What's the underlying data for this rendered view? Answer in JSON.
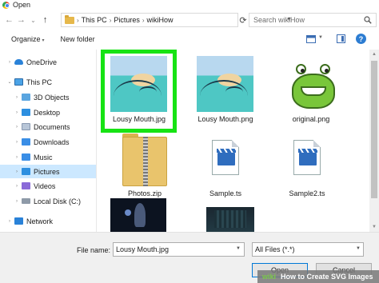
{
  "window": {
    "title": "Open"
  },
  "nav": {
    "back": "←",
    "forward": "→",
    "recent": "⌄",
    "up": "↑"
  },
  "address": {
    "crumbs": [
      "This PC",
      "Pictures",
      "wikiHow"
    ],
    "separator": "›",
    "refresh": "⟳"
  },
  "search": {
    "placeholder": "Search wikiHow",
    "icon": "search-icon"
  },
  "toolbar": {
    "organize": "Organize",
    "new_folder": "New folder",
    "help": "?"
  },
  "sidebar": {
    "items": [
      {
        "label": "OneDrive",
        "icon": "onedrive-icon"
      },
      {
        "label": "This PC",
        "icon": "pc-icon"
      },
      {
        "label": "3D Objects",
        "icon": "3d-objects-icon"
      },
      {
        "label": "Desktop",
        "icon": "desktop-icon"
      },
      {
        "label": "Documents",
        "icon": "documents-icon"
      },
      {
        "label": "Downloads",
        "icon": "downloads-icon"
      },
      {
        "label": "Music",
        "icon": "music-icon"
      },
      {
        "label": "Pictures",
        "icon": "pictures-icon",
        "selected": true
      },
      {
        "label": "Videos",
        "icon": "videos-icon"
      },
      {
        "label": "Local Disk (C:)",
        "icon": "disk-icon"
      },
      {
        "label": "Network",
        "icon": "network-icon"
      }
    ]
  },
  "files": [
    {
      "name": "Lousy Mouth.jpg",
      "selected": true
    },
    {
      "name": "Lousy Mouth.png"
    },
    {
      "name": "original.png"
    },
    {
      "name": "Photos.zip"
    },
    {
      "name": "Sample.ts"
    },
    {
      "name": "Sample2.ts"
    }
  ],
  "footer": {
    "file_name_label": "File name:",
    "file_name_value": "Lousy Mouth.jpg",
    "file_type": "All Files (*.*)",
    "open": "Open",
    "cancel": "Cancel"
  },
  "watermark": {
    "brand": "wiki",
    "caption": "How to Create SVG Images"
  },
  "colors": {
    "selection_highlight": "#17e314",
    "sidebar_selected": "#cce8ff",
    "accent": "#0078d7"
  }
}
